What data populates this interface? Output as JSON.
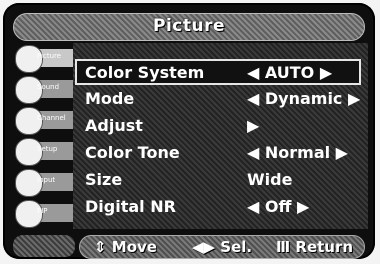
{
  "window": {
    "title": "Picture"
  },
  "sidebar": {
    "items": [
      {
        "label": "Picture"
      },
      {
        "label": "Sound"
      },
      {
        "label": "Channel"
      },
      {
        "label": "Setup"
      },
      {
        "label": "Input"
      },
      {
        "label": "PIP"
      }
    ]
  },
  "menu": {
    "items": [
      {
        "label": "Color System",
        "value": "◀  AUTO  ▶"
      },
      {
        "label": "Mode",
        "value": "◀  Dynamic  ▶"
      },
      {
        "label": "Adjust",
        "value": "▶"
      },
      {
        "label": "Color Tone",
        "value": "◀  Normal  ▶"
      },
      {
        "label": "Size",
        "value": "Wide"
      },
      {
        "label": "Digital NR",
        "value": "◀  Off  ▶"
      }
    ]
  },
  "footer": {
    "move": "⇕ Move",
    "select": "◀▶ Sel.",
    "return": "Ⅲ Return"
  }
}
